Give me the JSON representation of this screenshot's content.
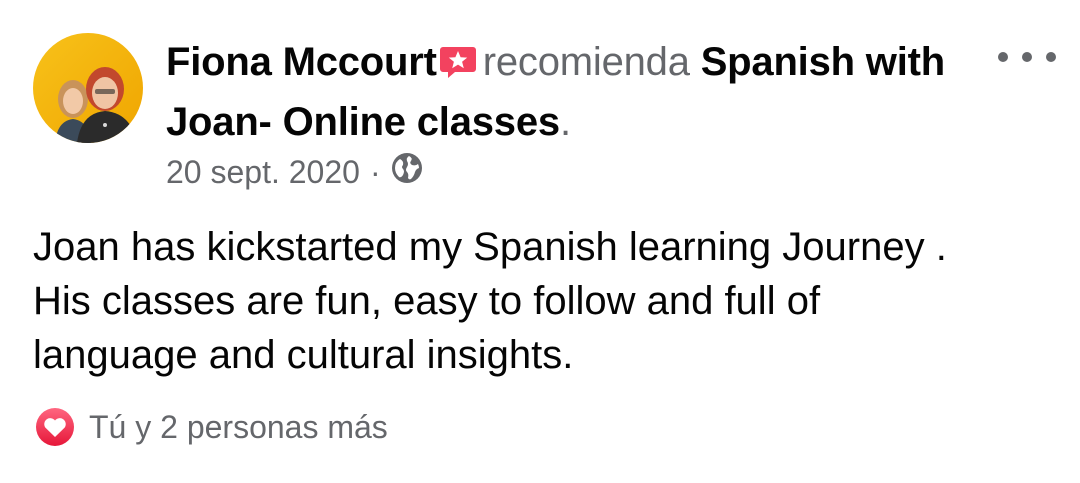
{
  "post": {
    "author_name": "Fiona Mccourt",
    "recommend_verb": "recomienda",
    "page_name": "Spanish with Joan- Online classes",
    "period": ".",
    "date": "20 sept. 2020",
    "separator": "·",
    "audience_icon": "globe-icon",
    "body_lines": [
      "Joan has kickstarted my Spanish learning Journey .",
      "His classes are fun, easy to follow and full of",
      "language and cultural insights."
    ],
    "reactions_text": "Tú y 2 personas más",
    "reaction_icon": "love-reaction-icon",
    "more_icon": "more-options-icon"
  },
  "colors": {
    "text_primary": "#050505",
    "text_secondary": "#65676b",
    "recommend_icon": "#f3425f",
    "love_reaction": "#f33e58",
    "avatar_bg": "#f5b400"
  }
}
